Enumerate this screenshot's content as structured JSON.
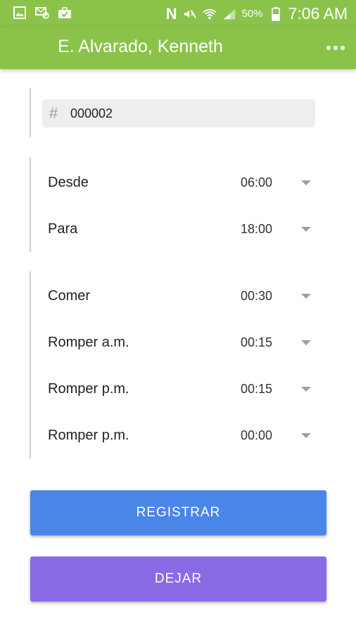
{
  "status_bar": {
    "battery": "50%",
    "time": "7:06 AM",
    "left_icons": [
      "image-icon",
      "sms-blocked-icon",
      "briefcase-check-icon"
    ],
    "right_icons": [
      "n-icon",
      "mute-icon",
      "wifi-icon",
      "signal-icon",
      "battery-icon"
    ]
  },
  "app_bar": {
    "title": "E. Alvarado, Kenneth",
    "menu_icon": "more-icon",
    "color": "#8bc34a"
  },
  "employee_id": {
    "icon": "hash",
    "value": "000002"
  },
  "schedule": [
    {
      "label": "Desde",
      "value": "06:00"
    },
    {
      "label": "Para",
      "value": "18:00"
    }
  ],
  "breaks": [
    {
      "label": "Comer",
      "value": "00:30"
    },
    {
      "label": "Romper a.m.",
      "value": "00:15"
    },
    {
      "label": "Romper p.m.",
      "value": "00:15"
    },
    {
      "label": "Romper p.m.",
      "value": "00:00"
    }
  ],
  "buttons": {
    "register_label": "REGISTRAR",
    "leave_label": "DEJAR",
    "register_color": "#4a86e8",
    "leave_color": "#8a6be6"
  }
}
